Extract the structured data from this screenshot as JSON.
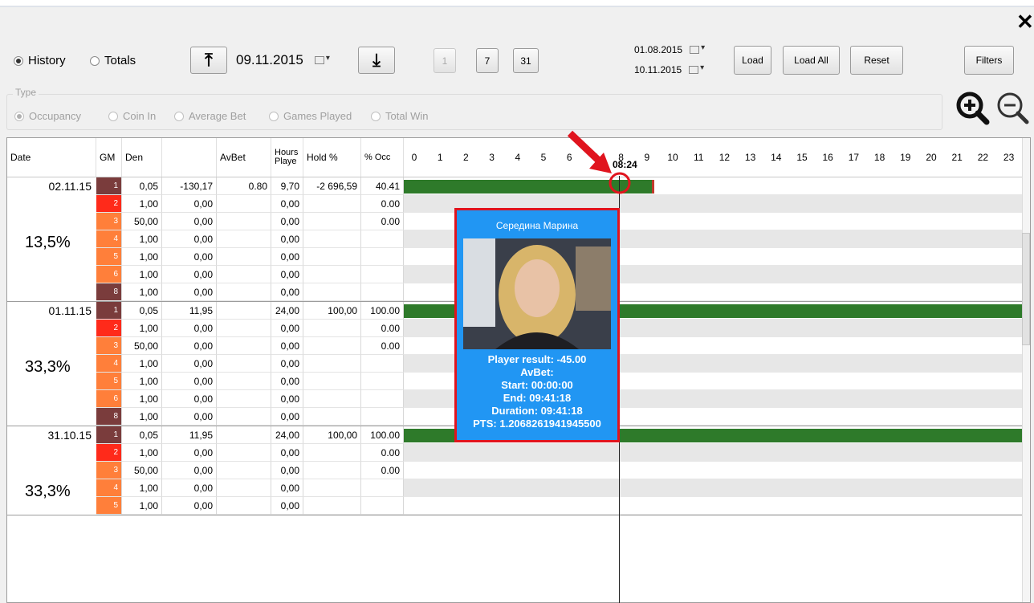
{
  "window": {
    "close": "✕"
  },
  "mode": {
    "history": "History",
    "totals": "Totals"
  },
  "date_nav": {
    "date": "09.11.2015",
    "up": "⤒",
    "down": "⤓"
  },
  "day_buttons": [
    "1",
    "7",
    "31"
  ],
  "range": {
    "from": "01.08.2015",
    "to": "10.11.2015"
  },
  "actions": {
    "load": "Load",
    "load_all": "Load All",
    "reset": "Reset",
    "filters": "Filters"
  },
  "type": {
    "label": "Type",
    "options": [
      "Occupancy",
      "Coin In",
      "Average Bet",
      "Games Played",
      "Total Win"
    ]
  },
  "columns": [
    "Date",
    "GM",
    "Den",
    "",
    "AvBet",
    "Hours Playe",
    "Hold %",
    "% Occ"
  ],
  "hours": [
    "0",
    "1",
    "2",
    "3",
    "4",
    "5",
    "6",
    "7",
    "8",
    "9",
    "10",
    "11",
    "12",
    "13",
    "14",
    "15",
    "16",
    "17",
    "18",
    "19",
    "20",
    "21",
    "22",
    "23"
  ],
  "gm_colors": {
    "1": "#7a3c3c",
    "2": "#ff2a1a",
    "3": "#ff7f3a",
    "4": "#ff7f3a",
    "5": "#ff7f3a",
    "6": "#ff7f3a",
    "8": "#7a3c3c"
  },
  "groups": [
    {
      "date": "02.11.15",
      "occ_pct": "13,5%",
      "rows": [
        {
          "gm": "1",
          "den": "0,05",
          "val": "-130,17",
          "avbet": "0.80",
          "hours": "9,70",
          "hold": "-2 696,59",
          "occ": "40.41",
          "bar_start": 0,
          "bar_end": 9.7
        },
        {
          "gm": "2",
          "den": "1,00",
          "val": "0,00",
          "avbet": "",
          "hours": "0,00",
          "hold": "",
          "occ": "0.00"
        },
        {
          "gm": "3",
          "den": "50,00",
          "val": "0,00",
          "avbet": "",
          "hours": "0,00",
          "hold": "",
          "occ": "0.00"
        },
        {
          "gm": "4",
          "den": "1,00",
          "val": "0,00",
          "avbet": "",
          "hours": "0,00",
          "hold": "",
          "occ": ""
        },
        {
          "gm": "5",
          "den": "1,00",
          "val": "0,00",
          "avbet": "",
          "hours": "0,00",
          "hold": "",
          "occ": ""
        },
        {
          "gm": "6",
          "den": "1,00",
          "val": "0,00",
          "avbet": "",
          "hours": "0,00",
          "hold": "",
          "occ": ""
        },
        {
          "gm": "8",
          "den": "1,00",
          "val": "0,00",
          "avbet": "",
          "hours": "0,00",
          "hold": "",
          "occ": ""
        }
      ]
    },
    {
      "date": "01.11.15",
      "occ_pct": "33,3%",
      "rows": [
        {
          "gm": "1",
          "den": "0,05",
          "val": "11,95",
          "avbet": "",
          "hours": "24,00",
          "hold": "100,00",
          "occ": "100.00",
          "bar_start": 0,
          "bar_end": 24
        },
        {
          "gm": "2",
          "den": "1,00",
          "val": "0,00",
          "avbet": "",
          "hours": "0,00",
          "hold": "",
          "occ": "0.00"
        },
        {
          "gm": "3",
          "den": "50,00",
          "val": "0,00",
          "avbet": "",
          "hours": "0,00",
          "hold": "",
          "occ": "0.00"
        },
        {
          "gm": "4",
          "den": "1,00",
          "val": "0,00",
          "avbet": "",
          "hours": "0,00",
          "hold": "",
          "occ": ""
        },
        {
          "gm": "5",
          "den": "1,00",
          "val": "0,00",
          "avbet": "",
          "hours": "0,00",
          "hold": "",
          "occ": ""
        },
        {
          "gm": "6",
          "den": "1,00",
          "val": "0,00",
          "avbet": "",
          "hours": "0,00",
          "hold": "",
          "occ": ""
        },
        {
          "gm": "8",
          "den": "1,00",
          "val": "0,00",
          "avbet": "",
          "hours": "0,00",
          "hold": "",
          "occ": ""
        }
      ]
    },
    {
      "date": "31.10.15",
      "occ_pct": "33,3%",
      "rows": [
        {
          "gm": "1",
          "den": "0,05",
          "val": "11,95",
          "avbet": "",
          "hours": "24,00",
          "hold": "100,00",
          "occ": "100.00",
          "bar_start": 0,
          "bar_end": 24
        },
        {
          "gm": "2",
          "den": "1,00",
          "val": "0,00",
          "avbet": "",
          "hours": "0,00",
          "hold": "",
          "occ": "0.00"
        },
        {
          "gm": "3",
          "den": "50,00",
          "val": "0,00",
          "avbet": "",
          "hours": "0,00",
          "hold": "",
          "occ": "0.00"
        },
        {
          "gm": "4",
          "den": "1,00",
          "val": "0,00",
          "avbet": "",
          "hours": "0,00",
          "hold": "",
          "occ": ""
        },
        {
          "gm": "5",
          "den": "1,00",
          "val": "0,00",
          "avbet": "",
          "hours": "0,00",
          "hold": "",
          "occ": ""
        }
      ]
    }
  ],
  "cursor": {
    "time": "08:24",
    "hour": 8.4
  },
  "popup": {
    "name": "Середина Марина",
    "lines": [
      "Player result: -45.00",
      "AvBet:",
      "Start: 00:00:00",
      "End: 09:41:18",
      "Duration: 09:41:18",
      "PTS: 1.2068261941945500"
    ]
  }
}
